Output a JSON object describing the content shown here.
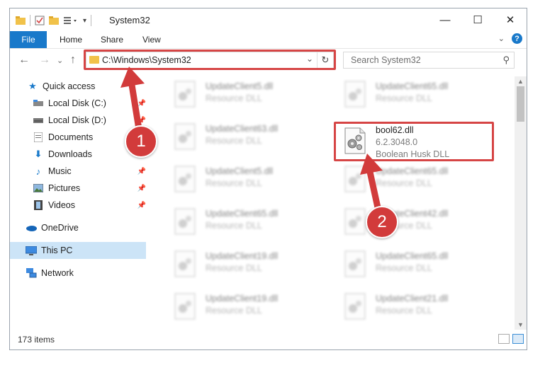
{
  "window": {
    "title": "System32"
  },
  "ribbon": {
    "tabs": [
      "File",
      "Home",
      "Share",
      "View"
    ],
    "help": "?"
  },
  "nav": {
    "back": "←",
    "forward": "→",
    "recent": "⌄",
    "up": "↑"
  },
  "address": {
    "path": "C:\\Windows\\System32"
  },
  "search": {
    "placeholder": "Search System32"
  },
  "navpane": {
    "items": [
      {
        "label": "Quick access",
        "icon": "star-icon"
      },
      {
        "label": "Local Disk (C:)",
        "icon": "drive-icon"
      },
      {
        "label": "Local Disk (D:)",
        "icon": "drive-icon"
      },
      {
        "label": "Documents",
        "icon": "documents-icon"
      },
      {
        "label": "Downloads",
        "icon": "downloads-icon"
      },
      {
        "label": "Music",
        "icon": "music-icon"
      },
      {
        "label": "Pictures",
        "icon": "pictures-icon"
      },
      {
        "label": "Videos",
        "icon": "videos-icon"
      },
      {
        "label": "OneDrive",
        "icon": "cloud-icon"
      },
      {
        "label": "This PC",
        "icon": "computer-icon"
      },
      {
        "label": "Network",
        "icon": "network-icon"
      }
    ]
  },
  "files": {
    "left": [
      {
        "name": "UpdateClient5.dll",
        "desc": "Resource DLL"
      },
      {
        "name": "UpdateClient63.dll",
        "desc": "Resource DLL"
      },
      {
        "name": "UpdateClient5.dll",
        "desc": "Resource DLL"
      },
      {
        "name": "UpdateClient65.dll",
        "desc": "Resource DLL"
      },
      {
        "name": "UpdateClient19.dll",
        "desc": "Resource DLL"
      },
      {
        "name": "UpdateClient19.dll",
        "desc": "Resource DLL"
      }
    ],
    "right": [
      {
        "name": "UpdateClient65.dll",
        "desc": "Resource DLL"
      },
      {
        "name": "UpdateClient65.dll",
        "desc": "Resource DLL"
      },
      {
        "name": "UpdateClient42.dll",
        "desc": "Resource DLL"
      },
      {
        "name": "UpdateClient65.dll",
        "desc": "Resource DLL"
      },
      {
        "name": "UpdateClient21.dll",
        "desc": "Resource DLL"
      }
    ],
    "highlighted": {
      "name": "bool62.dll",
      "version": "6.2.3048.0",
      "desc": "Boolean Husk DLL"
    }
  },
  "status": {
    "count": "173 items"
  },
  "callouts": {
    "one": "1",
    "two": "2",
    "color": "#d23b3b"
  }
}
